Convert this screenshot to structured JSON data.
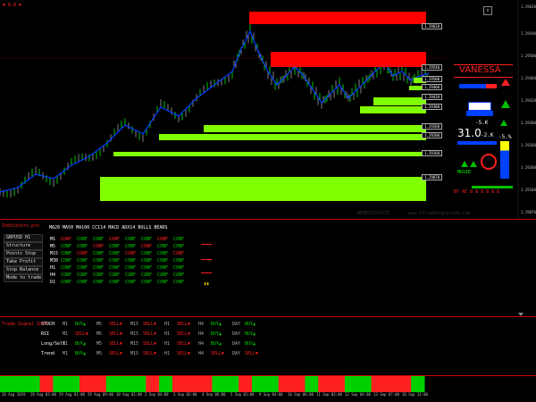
{
  "toolbar": {
    "top_left_label": "▼ 8.8 ▼",
    "close_label": "x"
  },
  "vanessa": {
    "title": "VANESSA",
    "big_value": "31.0",
    "pct_a": "-5.K",
    "pct_b": "-2.K",
    "pct_c": "-5.%",
    "arrow_label": "MGSIE",
    "bottom_label": "BY AE 8 8 8 8 8 8"
  },
  "watermark": "WERESTOSTATE . . . www.fxtradingsystem.com",
  "panel_title": "MA20  MA50  MA100  CCI14  MACD  ADX14  BULLS BEARS",
  "panel_header": "Indicators.pro",
  "menu": [
    {
      "label": "GBPUSD  H1"
    },
    {
      "label": "Structure"
    },
    {
      "label": "Points Stop"
    },
    {
      "label": "Take Profit"
    },
    {
      "label": "Stop Balance"
    },
    {
      "label": "Mode to trade"
    }
  ],
  "timeframes": [
    "M1",
    "M5",
    "M15",
    "M30",
    "H1",
    "H4",
    "D1"
  ],
  "signal_text": "CONF",
  "bottom_panel_header": "Trade Signal Info",
  "signals": [
    {
      "name": "STOCH",
      "cells": [
        "BUY",
        "SELL",
        "SELL",
        "SELL",
        "BUY",
        "BUY"
      ]
    },
    {
      "name": "RSI",
      "cells": [
        "SELL",
        "SELL",
        "SELL",
        "SELL",
        "BUY",
        "BUY"
      ]
    },
    {
      "name": "Long/Sell",
      "cells": [
        "BUY",
        "SELL",
        "SELL",
        "SELL",
        "BUY",
        "BUY"
      ]
    },
    {
      "name": "Trend",
      "cells": [
        "BUY",
        "SELL",
        "SELL",
        "SELL",
        "SELL",
        "SELL"
      ]
    }
  ],
  "signal_cols": [
    "M1",
    "M5",
    "M15",
    "H1",
    "H4",
    "DAY"
  ],
  "price_levels": [
    "1.29620",
    "1.29540",
    "1.29500",
    "1.29460",
    "1.29420",
    "1.29380",
    "1.29260",
    "1.29200",
    "1.29160",
    "1.29070"
  ],
  "price_tag_level": "1.29544",
  "x_axis": [
    "28 Aug 2019",
    "28 Aug 03:00",
    "29 Aug 01:00",
    "29 Aug 09:00",
    "30 Aug 02:00",
    "2 Sep 04:00",
    "3 Sep 02:00",
    "4 Sep 06:00",
    "5 Sep 01:00",
    "9 Sep 04:00",
    "10 Sep 06:00",
    "11 Sep 02:00",
    "12 Sep 04:00",
    "13 Sep 07:00",
    "16 Sep 12:00"
  ],
  "colors": {
    "red_zone": "#ff0000",
    "green_zone": "#80ff00",
    "buy": "#00d000",
    "sell": "#ff2020"
  }
}
